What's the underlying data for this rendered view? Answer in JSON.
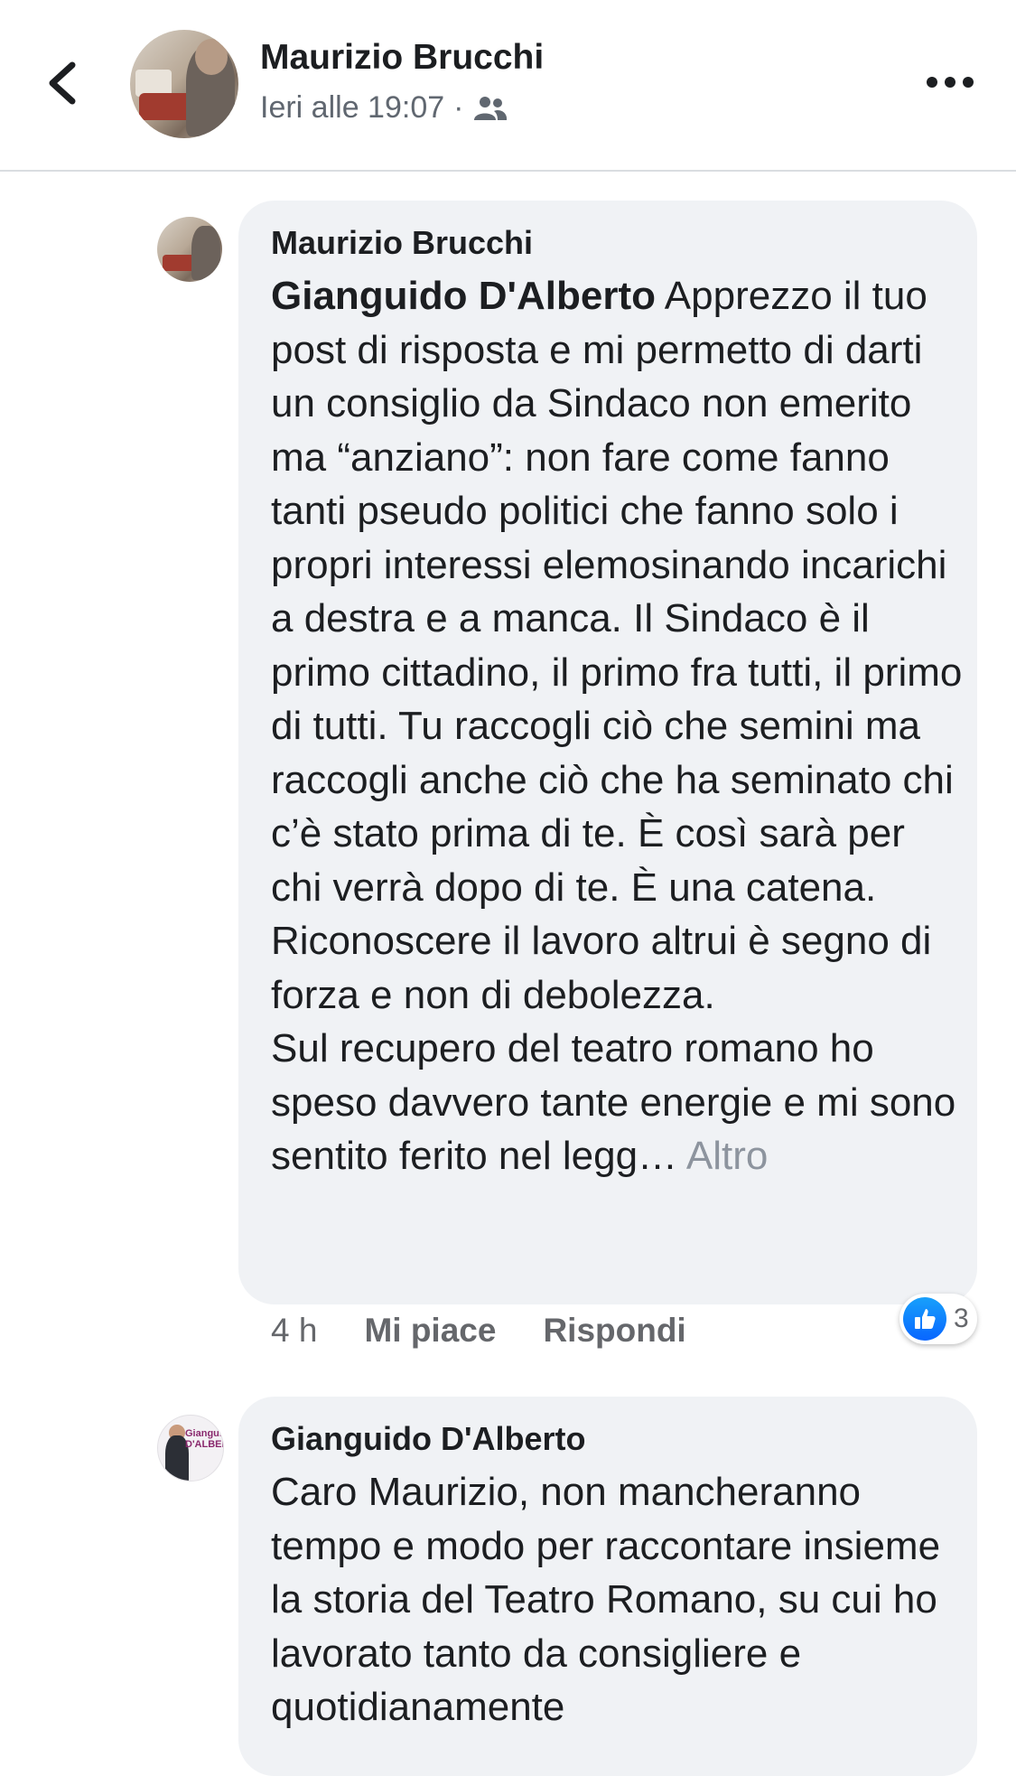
{
  "header": {
    "author": "Maurizio Brucchi",
    "time": "Ieri alle 19:07",
    "separator": "·",
    "audience_icon": "friends-icon",
    "back_icon": "chevron-left-icon",
    "more_icon": "more-horizontal-icon"
  },
  "comments": [
    {
      "author": "Maurizio Brucchi",
      "tag": "Gianguido D'Alberto",
      "body": " Apprezzo il tuo post di risposta e mi permetto di darti un consiglio da Sindaco non emerito ma “anziano”: non fare come fanno tanti pseudo politici che fanno solo i propri interessi elemosinando incarichi a destra e a manca. Il Sindaco è il primo cittadino, il primo fra tutti, il primo di tutti. Tu raccogli ciò che semini ma raccogli anche ciò che ha seminato chi c’è stato prima di te. È così sarà per chi verrà dopo di te. È una catena. Riconoscere il lavoro altrui è segno di forza e non di debolezza.",
      "body2": "Sul recupero del teatro romano ho speso davvero tante energie e mi sono sentito ferito nel legg…",
      "more_label": " Altro",
      "time": "4 h",
      "like_label": "Mi piace",
      "reply_label": "Rispondi",
      "reaction_count": "3",
      "reaction_icon": "like-reaction-icon"
    },
    {
      "author": "Gianguido D'Alberto",
      "body": "Caro Maurizio, non mancheranno tempo e modo per raccontare insieme la storia del Teatro Romano, su cui ho lavorato tanto da consigliere e quotidianamente",
      "avatar_text": "Gianguido D'ALBERTO"
    }
  ],
  "colors": {
    "bubble": "#f0f2f5",
    "secondary_text": "#606770",
    "like_blue": "#0866ff"
  }
}
